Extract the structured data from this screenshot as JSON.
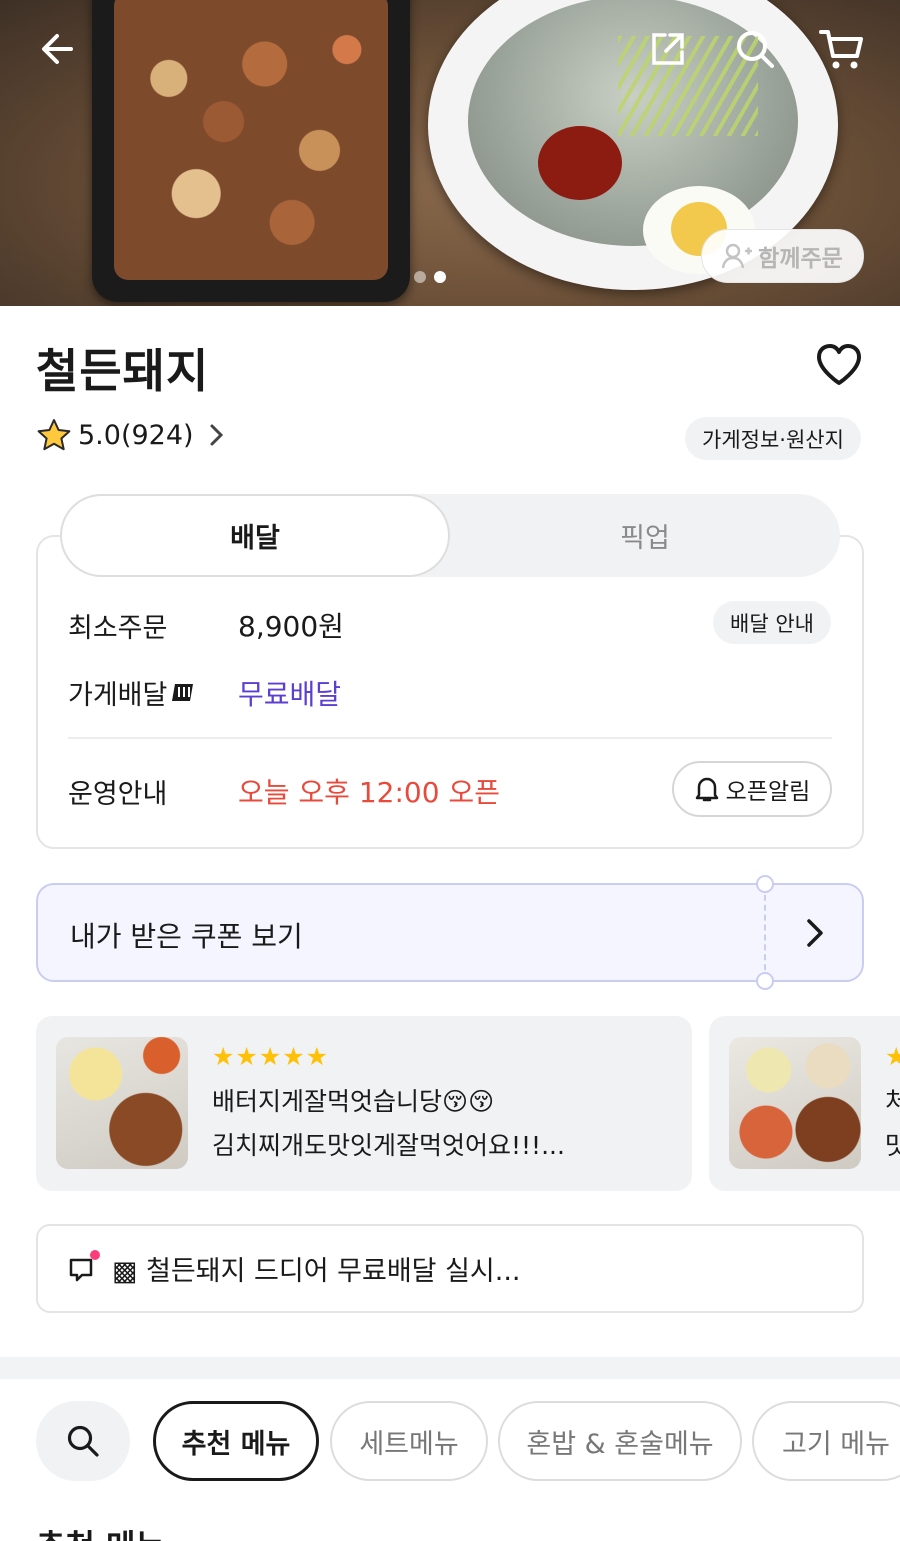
{
  "store": {
    "name": "철든돼지",
    "rating": "5.0(924)",
    "info_label": "가게정보·원산지"
  },
  "hero": {
    "together_label": "함께주문"
  },
  "order_tabs": {
    "delivery": "배달",
    "pickup": "픽업"
  },
  "delivery_info": {
    "min_order_label": "최소주문",
    "min_order_value": "8,900원",
    "delivery_guide": "배달 안내",
    "store_delivery_label": "가게배달",
    "store_delivery_value": "무료배달",
    "hours_label": "운영안내",
    "hours_value": "오늘 오후 12:00 오픈",
    "open_alarm": "오픈알림"
  },
  "coupon": {
    "label": "내가 받은 쿠폰 보기"
  },
  "reviews": [
    {
      "stars": "★★★★★",
      "line1": "배터지게잘먹엇습니당😚😚",
      "line2": "김치찌개도맛잇게잘먹엇어요!!!..."
    },
    {
      "stars": "★",
      "line1": "처",
      "line2": "맛"
    }
  ],
  "notice": {
    "text": "▩ 철든돼지 드디어 무료배달 실시..."
  },
  "categories": {
    "items": [
      "추천 메뉴",
      "세트메뉴",
      "혼밥 & 혼술메뉴",
      "고기 메뉴"
    ]
  },
  "section_title": "추천 메뉴",
  "colors": {
    "accent_purple": "#5b3fd1",
    "alert_red": "#e84a3b",
    "star_yellow": "#ffc107"
  }
}
